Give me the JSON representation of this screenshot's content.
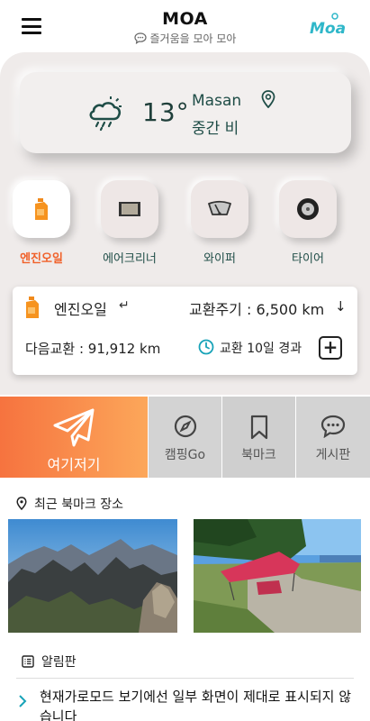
{
  "header": {
    "title": "MOA",
    "subtitle": "즐거움을 모아 모아",
    "logo_text": "Moa",
    "menu_icon": "hamburger-menu-icon"
  },
  "weather": {
    "temperature": "13°",
    "city": "Masan",
    "condition": "중간 비",
    "icon": "cloud-rain-sun-icon",
    "location_icon": "map-pin-icon"
  },
  "categories": [
    {
      "label": "엔진오일",
      "icon": "oil-bottle-icon",
      "active": true
    },
    {
      "label": "에어크리너",
      "icon": "air-filter-icon",
      "active": false
    },
    {
      "label": "와이퍼",
      "icon": "wiper-icon",
      "active": false
    },
    {
      "label": "타이어",
      "icon": "tire-icon",
      "active": false
    }
  ],
  "info": {
    "name": "엔진오일",
    "return_symbol": "↵",
    "cycle": "교환주기 : 6,500 km",
    "down_symbol": "↓",
    "next": "다음교환 : 91,912 km",
    "elapsed": "교환 10일 경과",
    "add_symbol": "+"
  },
  "menu": {
    "main_label": "여기저기",
    "items": [
      {
        "label": "캠핑Go",
        "icon": "compass-icon"
      },
      {
        "label": "북마크",
        "icon": "bookmark-icon"
      },
      {
        "label": "게시판",
        "icon": "chat-bubble-icon"
      }
    ]
  },
  "bookmarks": {
    "heading": "최근 북마크 장소"
  },
  "notice_board": {
    "heading": "알림판",
    "items": [
      "현재가로모드 보기에선 일부 화면이 제대로 표시되지 않습니다"
    ]
  },
  "colors": {
    "accent": "#f0612a",
    "teal": "#1f4d47",
    "panel": "#efebea"
  }
}
